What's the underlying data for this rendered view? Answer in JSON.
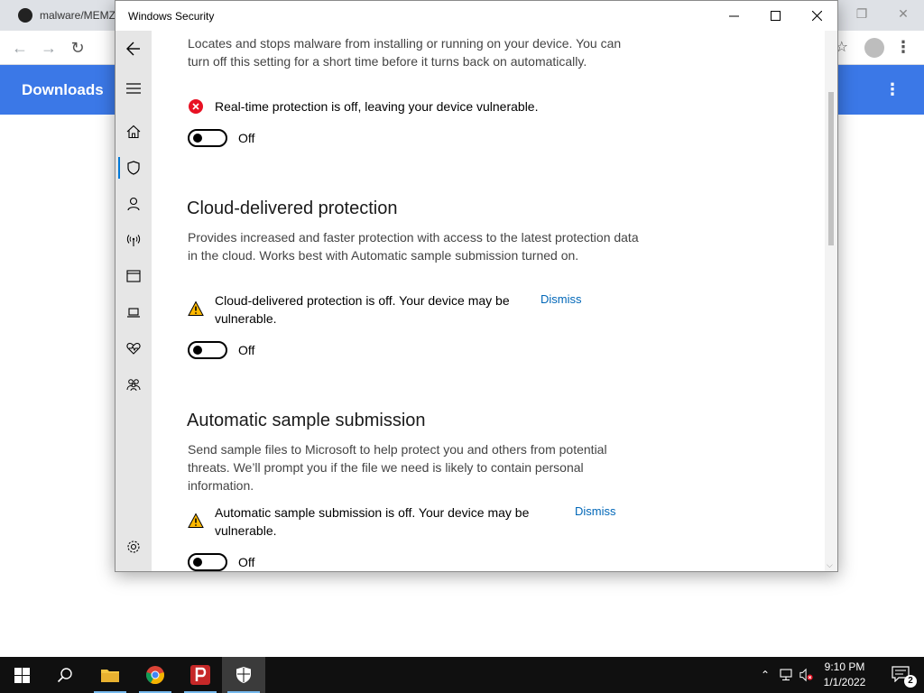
{
  "browser": {
    "tab_title": "malware/MEMZ",
    "appbar_title": "Downloads"
  },
  "window": {
    "title": "Windows Security"
  },
  "sections": {
    "realtime": {
      "description": "Locates and stops malware from installing or running on your device. You can turn off this setting for a short time before it turns back on automatically.",
      "alert": "Real-time protection is off, leaving your device vulnerable.",
      "toggle_label": "Off"
    },
    "cloud": {
      "title": "Cloud-delivered protection",
      "description": "Provides increased and faster protection with access to the latest protection data in the cloud. Works best with Automatic sample submission turned on.",
      "alert": "Cloud-delivered protection is off. Your device may be vulnerable.",
      "dismiss": "Dismiss",
      "toggle_label": "Off"
    },
    "sample": {
      "title": "Automatic sample submission",
      "description": "Send sample files to Microsoft to help protect you and others from potential threats. We’ll prompt you if the file we need is likely to contain personal information.",
      "alert": "Automatic sample submission is off. Your device may be vulnerable.",
      "dismiss": "Dismiss",
      "toggle_label": "Off"
    }
  },
  "taskbar": {
    "time": "9:10 PM",
    "date": "1/1/2022",
    "notification_count": "2"
  },
  "colors": {
    "accent": "#0078d7",
    "link": "#0067b8",
    "error": "#e81123",
    "warning": "#ffb900",
    "browser_appbar": "#3b78e7"
  }
}
